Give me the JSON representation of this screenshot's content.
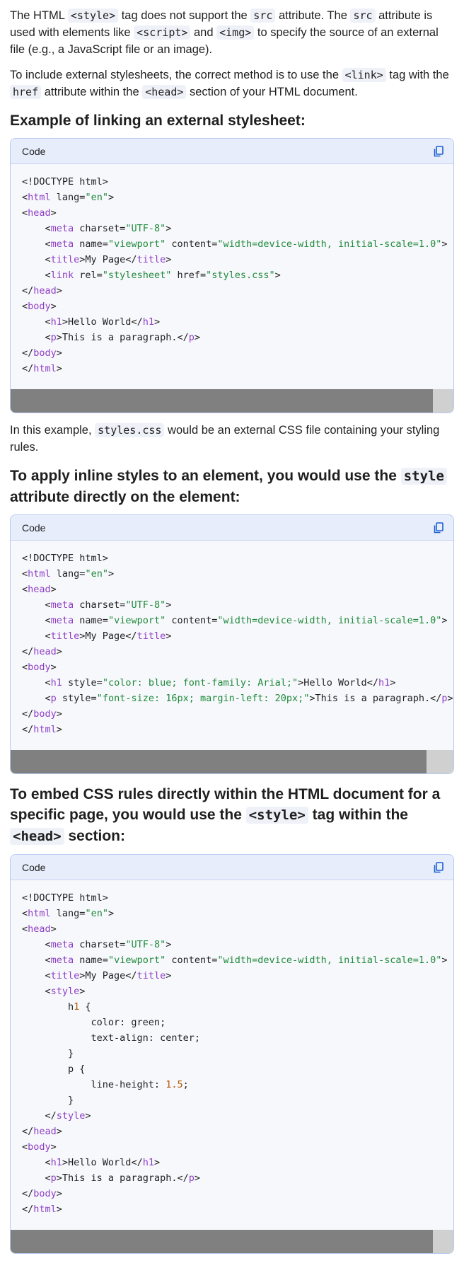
{
  "intro": {
    "p1": {
      "t1": "The HTML ",
      "c1": "<style>",
      "t2": " tag does not support the ",
      "c2": "src",
      "t3": " attribute. The ",
      "c3": "src",
      "t4": " attribute is used with elements like ",
      "c4": "<script>",
      "t5": " and ",
      "c5": "<img>",
      "t6": " to specify the source of an external file (e.g., a JavaScript file or an image)."
    },
    "p2": {
      "t1": "To include external stylesheets, the correct method is to use the ",
      "c1": "<link>",
      "t2": " tag with the ",
      "c2": "href",
      "t3": " attribute within the ",
      "c3": "<head>",
      "t4": " section of your HTML document."
    }
  },
  "section1": {
    "heading": "Example of linking an external stylesheet:",
    "code_label": "Code",
    "after": {
      "t1": "In this example, ",
      "c1": "styles.css",
      "t2": " would be an external CSS file containing your styling rules."
    }
  },
  "section2": {
    "heading": {
      "t1": "To apply inline styles to an element, you would use the ",
      "c1": "style",
      "t2": " attribute directly on the element:"
    },
    "code_label": "Code"
  },
  "section3": {
    "heading": {
      "t1": "To embed CSS rules directly within the HTML document for a specific page, you would use the ",
      "c1": "<style>",
      "t2": " tag within the ",
      "c2": "<head>",
      "t3": " section:"
    },
    "code_label": "Code"
  },
  "code_blocks": [
    {
      "scroll_fraction": 0.954,
      "lines": [
        [
          [
            "",
            "<!DOCTYPE html>"
          ]
        ],
        [
          [
            "",
            "<"
          ],
          [
            "tg",
            "html"
          ],
          [
            "",
            " lang="
          ],
          [
            "st",
            "\"en\""
          ],
          [
            "",
            ">"
          ]
        ],
        [
          [
            "",
            "<"
          ],
          [
            "tg",
            "head"
          ],
          [
            "",
            ">"
          ]
        ],
        [
          [
            "",
            "    <"
          ],
          [
            "tg",
            "meta"
          ],
          [
            "",
            " charset="
          ],
          [
            "st",
            "\"UTF-8\""
          ],
          [
            "",
            ">"
          ]
        ],
        [
          [
            "",
            "    <"
          ],
          [
            "tg",
            "meta"
          ],
          [
            "",
            " name="
          ],
          [
            "st",
            "\"viewport\""
          ],
          [
            "",
            " content="
          ],
          [
            "st",
            "\"width=device-width, initial-scale=1.0\""
          ],
          [
            "",
            ">"
          ]
        ],
        [
          [
            "",
            "    <"
          ],
          [
            "tg",
            "title"
          ],
          [
            "",
            ">My Page</"
          ],
          [
            "tg",
            "title"
          ],
          [
            "",
            ">"
          ]
        ],
        [
          [
            "",
            "    <"
          ],
          [
            "tg",
            "link"
          ],
          [
            "",
            " rel="
          ],
          [
            "st",
            "\"stylesheet\""
          ],
          [
            "",
            " href="
          ],
          [
            "st",
            "\"styles.css\""
          ],
          [
            "",
            ">"
          ]
        ],
        [
          [
            "",
            "</"
          ],
          [
            "tg",
            "head"
          ],
          [
            "",
            ">"
          ]
        ],
        [
          [
            "",
            "<"
          ],
          [
            "tg",
            "body"
          ],
          [
            "",
            ">"
          ]
        ],
        [
          [
            "",
            "    <"
          ],
          [
            "tg",
            "h1"
          ],
          [
            "",
            ">Hello World</"
          ],
          [
            "tg",
            "h1"
          ],
          [
            "",
            ">"
          ]
        ],
        [
          [
            "",
            "    <"
          ],
          [
            "tg",
            "p"
          ],
          [
            "",
            ">This is a paragraph.</"
          ],
          [
            "tg",
            "p"
          ],
          [
            "",
            ">"
          ]
        ],
        [
          [
            "",
            "</"
          ],
          [
            "tg",
            "body"
          ],
          [
            "",
            ">"
          ]
        ],
        [
          [
            "",
            "</"
          ],
          [
            "tg",
            "html"
          ],
          [
            "",
            ">"
          ]
        ]
      ]
    },
    {
      "scroll_fraction": 0.939,
      "lines": [
        [
          [
            "",
            "<!DOCTYPE html>"
          ]
        ],
        [
          [
            "",
            "<"
          ],
          [
            "tg",
            "html"
          ],
          [
            "",
            " lang="
          ],
          [
            "st",
            "\"en\""
          ],
          [
            "",
            ">"
          ]
        ],
        [
          [
            "",
            "<"
          ],
          [
            "tg",
            "head"
          ],
          [
            "",
            ">"
          ]
        ],
        [
          [
            "",
            "    <"
          ],
          [
            "tg",
            "meta"
          ],
          [
            "",
            " charset="
          ],
          [
            "st",
            "\"UTF-8\""
          ],
          [
            "",
            ">"
          ]
        ],
        [
          [
            "",
            "    <"
          ],
          [
            "tg",
            "meta"
          ],
          [
            "",
            " name="
          ],
          [
            "st",
            "\"viewport\""
          ],
          [
            "",
            " content="
          ],
          [
            "st",
            "\"width=device-width, initial-scale=1.0\""
          ],
          [
            "",
            ">"
          ]
        ],
        [
          [
            "",
            "    <"
          ],
          [
            "tg",
            "title"
          ],
          [
            "",
            ">My Page</"
          ],
          [
            "tg",
            "title"
          ],
          [
            "",
            ">"
          ]
        ],
        [
          [
            "",
            "</"
          ],
          [
            "tg",
            "head"
          ],
          [
            "",
            ">"
          ]
        ],
        [
          [
            "",
            "<"
          ],
          [
            "tg",
            "body"
          ],
          [
            "",
            ">"
          ]
        ],
        [
          [
            "",
            "    <"
          ],
          [
            "tg",
            "h1"
          ],
          [
            "",
            " style="
          ],
          [
            "st",
            "\"color: blue; font-family: Arial;\""
          ],
          [
            "",
            ">Hello World</"
          ],
          [
            "tg",
            "h1"
          ],
          [
            "",
            ">"
          ]
        ],
        [
          [
            "",
            "    <"
          ],
          [
            "tg",
            "p"
          ],
          [
            "",
            " style="
          ],
          [
            "st",
            "\"font-size: 16px; margin-left: 20px;\""
          ],
          [
            "",
            ">This is a paragraph.</"
          ],
          [
            "tg",
            "p"
          ],
          [
            "",
            ">"
          ]
        ],
        [
          [
            "",
            "</"
          ],
          [
            "tg",
            "body"
          ],
          [
            "",
            ">"
          ]
        ],
        [
          [
            "",
            "</"
          ],
          [
            "tg",
            "html"
          ],
          [
            "",
            ">"
          ]
        ]
      ]
    },
    {
      "scroll_fraction": 0.954,
      "lines": [
        [
          [
            "",
            "<!DOCTYPE html>"
          ]
        ],
        [
          [
            "",
            "<"
          ],
          [
            "tg",
            "html"
          ],
          [
            "",
            " lang="
          ],
          [
            "st",
            "\"en\""
          ],
          [
            "",
            ">"
          ]
        ],
        [
          [
            "",
            "<"
          ],
          [
            "tg",
            "head"
          ],
          [
            "",
            ">"
          ]
        ],
        [
          [
            "",
            "    <"
          ],
          [
            "tg",
            "meta"
          ],
          [
            "",
            " charset="
          ],
          [
            "st",
            "\"UTF-8\""
          ],
          [
            "",
            ">"
          ]
        ],
        [
          [
            "",
            "    <"
          ],
          [
            "tg",
            "meta"
          ],
          [
            "",
            " name="
          ],
          [
            "st",
            "\"viewport\""
          ],
          [
            "",
            " content="
          ],
          [
            "st",
            "\"width=device-width, initial-scale=1.0\""
          ],
          [
            "",
            ">"
          ]
        ],
        [
          [
            "",
            "    <"
          ],
          [
            "tg",
            "title"
          ],
          [
            "",
            ">My Page</"
          ],
          [
            "tg",
            "title"
          ],
          [
            "",
            ">"
          ]
        ],
        [
          [
            "",
            "    <"
          ],
          [
            "tg",
            "style"
          ],
          [
            "",
            ">"
          ]
        ],
        [
          [
            "",
            "        h"
          ],
          [
            "nm",
            "1"
          ],
          [
            "",
            " {"
          ]
        ],
        [
          [
            "",
            "            color: green;"
          ]
        ],
        [
          [
            "",
            "            text-align: center;"
          ]
        ],
        [
          [
            "",
            "        }"
          ]
        ],
        [
          [
            "",
            "        p {"
          ]
        ],
        [
          [
            "",
            "            line-height: "
          ],
          [
            "nm",
            "1.5"
          ],
          [
            "",
            ";"
          ]
        ],
        [
          [
            "",
            "        }"
          ]
        ],
        [
          [
            "",
            "    </"
          ],
          [
            "tg",
            "style"
          ],
          [
            "",
            ">"
          ]
        ],
        [
          [
            "",
            "</"
          ],
          [
            "tg",
            "head"
          ],
          [
            "",
            ">"
          ]
        ],
        [
          [
            "",
            "<"
          ],
          [
            "tg",
            "body"
          ],
          [
            "",
            ">"
          ]
        ],
        [
          [
            "",
            "    <"
          ],
          [
            "tg",
            "h1"
          ],
          [
            "",
            ">Hello World</"
          ],
          [
            "tg",
            "h1"
          ],
          [
            "",
            ">"
          ]
        ],
        [
          [
            "",
            "    <"
          ],
          [
            "tg",
            "p"
          ],
          [
            "",
            ">This is a paragraph.</"
          ],
          [
            "tg",
            "p"
          ],
          [
            "",
            ">"
          ]
        ],
        [
          [
            "",
            "</"
          ],
          [
            "tg",
            "body"
          ],
          [
            "",
            ">"
          ]
        ],
        [
          [
            "",
            "</"
          ],
          [
            "tg",
            "html"
          ],
          [
            "",
            ">"
          ]
        ]
      ]
    }
  ]
}
